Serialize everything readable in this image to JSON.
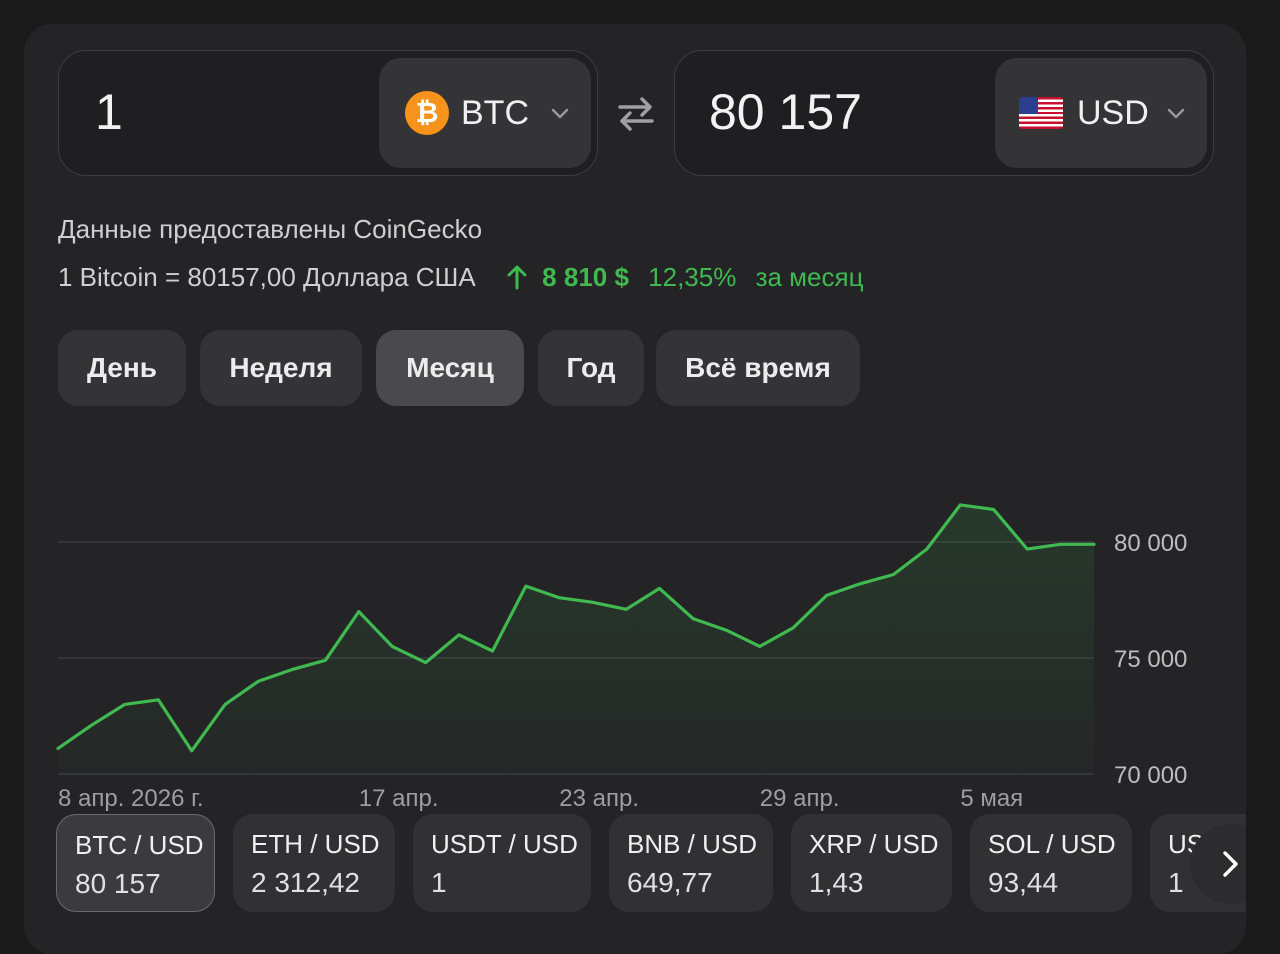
{
  "converter": {
    "from_amount": "1",
    "from_currency": "BTC",
    "to_amount": "80 157",
    "to_currency": "USD"
  },
  "info": {
    "provider": "Данные предоставлены CoinGecko",
    "rate": "1 Bitcoin = 80157,00 Доллара США",
    "change_value": "8 810 $",
    "change_percent": "12,35%",
    "change_period": "за месяц"
  },
  "tabs": [
    {
      "label": "День",
      "active": false
    },
    {
      "label": "Неделя",
      "active": false
    },
    {
      "label": "Месяц",
      "active": true
    },
    {
      "label": "Год",
      "active": false
    },
    {
      "label": "Всё время",
      "active": false
    }
  ],
  "chart_data": {
    "type": "area",
    "x_ticks": [
      "8 апр. 2026 г.",
      "17 апр.",
      "23 апр.",
      "29 апр.",
      "5 мая"
    ],
    "y_ticks": [
      "80 000",
      "75 000",
      "70 000"
    ],
    "y_tick_values": [
      80000,
      75000,
      70000
    ],
    "ylim": [
      70000,
      82500
    ],
    "values": [
      71100,
      72100,
      73000,
      73200,
      71000,
      73000,
      74000,
      74500,
      74900,
      77000,
      75500,
      74800,
      76000,
      75300,
      78100,
      77600,
      77400,
      77100,
      78000,
      76700,
      76200,
      75500,
      76300,
      77700,
      78200,
      78600,
      79700,
      81600,
      81400,
      79700,
      79900,
      79900
    ],
    "x_tick_index": [
      0,
      9,
      15,
      21,
      27
    ],
    "color": "#3fb950",
    "grid": true
  },
  "pairs": [
    {
      "name": "BTC / USD",
      "value": "80 157",
      "active": true
    },
    {
      "name": "ETH / USD",
      "value": "2 312,42",
      "active": false
    },
    {
      "name": "USDT / USD",
      "value": "1",
      "active": false
    },
    {
      "name": "BNB / USD",
      "value": "649,77",
      "active": false
    },
    {
      "name": "XRP / USD",
      "value": "1,43",
      "active": false
    },
    {
      "name": "SOL / USD",
      "value": "93,44",
      "active": false
    },
    {
      "name": "USDC / USD",
      "value": "1",
      "active": false
    }
  ],
  "icons": {
    "from_coin": "bitcoin-icon",
    "to_flag": "us-flag-icon",
    "swap": "swap-arrows-icon",
    "trend": "arrow-up-icon",
    "next": "chevron-right-icon"
  },
  "colors": {
    "accent_green": "#3fb950",
    "bitcoin_orange": "#f7931a"
  }
}
